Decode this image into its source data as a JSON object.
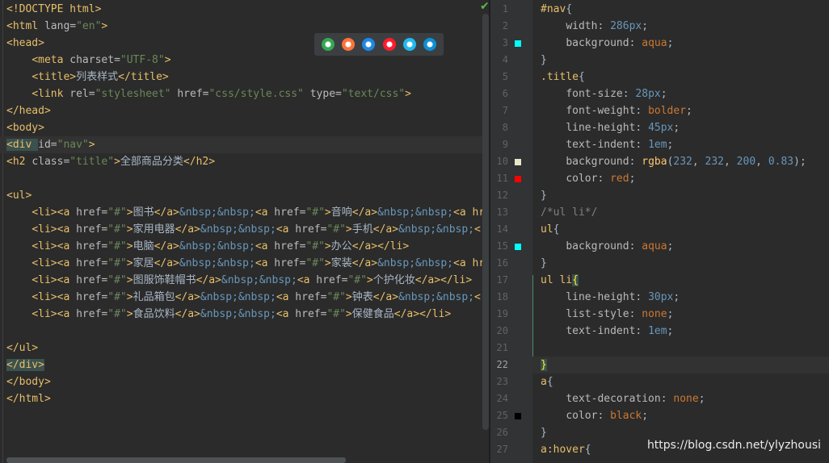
{
  "html_editor": {
    "lines": [
      [
        [
          "tag",
          "<!DOCTYPE html>"
        ]
      ],
      [
        [
          "tag",
          "<html "
        ],
        [
          "attr",
          "lang="
        ],
        [
          "str",
          "\"en\""
        ],
        [
          "tag",
          ">"
        ]
      ],
      [
        [
          "tag",
          "<head>"
        ]
      ],
      [
        [
          "txt",
          "    "
        ],
        [
          "tag",
          "<meta "
        ],
        [
          "attr",
          "charset="
        ],
        [
          "str",
          "\"UTF-8\""
        ],
        [
          "tag",
          ">"
        ]
      ],
      [
        [
          "txt",
          "    "
        ],
        [
          "tag",
          "<title>"
        ],
        [
          "txt",
          "列表样式"
        ],
        [
          "tag",
          "</title>"
        ]
      ],
      [
        [
          "txt",
          "    "
        ],
        [
          "tag",
          "<link "
        ],
        [
          "attr",
          "rel="
        ],
        [
          "str",
          "\"stylesheet\""
        ],
        [
          "attr",
          " href="
        ],
        [
          "str",
          "\"css/style.css\""
        ],
        [
          "attr",
          " type="
        ],
        [
          "str",
          "\"text/css\""
        ],
        [
          "tag",
          ">"
        ]
      ],
      [
        [
          "tag",
          "</head>"
        ]
      ],
      [
        [
          "tag",
          "<body>"
        ]
      ],
      [
        [
          "tag",
          "<div "
        ],
        [
          "attr",
          "id="
        ],
        [
          "str",
          "\"nav\""
        ],
        [
          "tag",
          ">"
        ]
      ],
      [
        [
          "tag",
          "<h2 "
        ],
        [
          "attr",
          "class="
        ],
        [
          "str",
          "\"title\""
        ],
        [
          "tag",
          ">"
        ],
        [
          "txt",
          "全部商品分类"
        ],
        [
          "tag",
          "</h2>"
        ]
      ],
      [],
      [
        [
          "tag",
          "<ul>"
        ]
      ],
      [
        [
          "txt",
          "    "
        ],
        [
          "tag",
          "<li><a "
        ],
        [
          "attr",
          "href="
        ],
        [
          "str",
          "\"#\""
        ],
        [
          "tag",
          ">"
        ],
        [
          "txt",
          "图书"
        ],
        [
          "tag",
          "</a>"
        ],
        [
          "ent",
          "&nbsp;&nbsp;"
        ],
        [
          "tag",
          "<a "
        ],
        [
          "attr",
          "href="
        ],
        [
          "str",
          "\"#\""
        ],
        [
          "tag",
          ">"
        ],
        [
          "txt",
          "音响"
        ],
        [
          "tag",
          "</a>"
        ],
        [
          "ent",
          "&nbsp;&nbsp;"
        ],
        [
          "tag",
          "<a hr"
        ]
      ],
      [
        [
          "txt",
          "    "
        ],
        [
          "tag",
          "<li><a "
        ],
        [
          "attr",
          "href="
        ],
        [
          "str",
          "\"#\""
        ],
        [
          "tag",
          ">"
        ],
        [
          "txt",
          "家用电器"
        ],
        [
          "tag",
          "</a>"
        ],
        [
          "ent",
          "&nbsp;&nbsp;"
        ],
        [
          "tag",
          "<a "
        ],
        [
          "attr",
          "href="
        ],
        [
          "str",
          "\"#\""
        ],
        [
          "tag",
          ">"
        ],
        [
          "txt",
          "手机"
        ],
        [
          "tag",
          "</a>"
        ],
        [
          "ent",
          "&nbsp;&nbsp;"
        ],
        [
          "tag",
          "<"
        ]
      ],
      [
        [
          "txt",
          "    "
        ],
        [
          "tag",
          "<li><a "
        ],
        [
          "attr",
          "href="
        ],
        [
          "str",
          "\"#\""
        ],
        [
          "tag",
          ">"
        ],
        [
          "txt",
          "电脑"
        ],
        [
          "tag",
          "</a>"
        ],
        [
          "ent",
          "&nbsp;&nbsp;"
        ],
        [
          "tag",
          "<a "
        ],
        [
          "attr",
          "href="
        ],
        [
          "str",
          "\"#\""
        ],
        [
          "tag",
          ">"
        ],
        [
          "txt",
          "办公"
        ],
        [
          "tag",
          "</a></li>"
        ]
      ],
      [
        [
          "txt",
          "    "
        ],
        [
          "tag",
          "<li><a "
        ],
        [
          "attr",
          "href="
        ],
        [
          "str",
          "\"#\""
        ],
        [
          "tag",
          ">"
        ],
        [
          "txt",
          "家居"
        ],
        [
          "tag",
          "</a>"
        ],
        [
          "ent",
          "&nbsp;&nbsp;"
        ],
        [
          "tag",
          "<a "
        ],
        [
          "attr",
          "href="
        ],
        [
          "str",
          "\"#\""
        ],
        [
          "tag",
          ">"
        ],
        [
          "txt",
          "家装"
        ],
        [
          "tag",
          "</a>"
        ],
        [
          "ent",
          "&nbsp;&nbsp;"
        ],
        [
          "tag",
          "<a hr"
        ]
      ],
      [
        [
          "txt",
          "    "
        ],
        [
          "tag",
          "<li><a "
        ],
        [
          "attr",
          "href="
        ],
        [
          "str",
          "\"#\""
        ],
        [
          "tag",
          ">"
        ],
        [
          "txt",
          "图服饰鞋帽书"
        ],
        [
          "tag",
          "</a>"
        ],
        [
          "ent",
          "&nbsp;&nbsp;"
        ],
        [
          "tag",
          "<a "
        ],
        [
          "attr",
          "href="
        ],
        [
          "str",
          "\"#\""
        ],
        [
          "tag",
          ">"
        ],
        [
          "txt",
          "个护化妆"
        ],
        [
          "tag",
          "</a></li>"
        ]
      ],
      [
        [
          "txt",
          "    "
        ],
        [
          "tag",
          "<li><a "
        ],
        [
          "attr",
          "href="
        ],
        [
          "str",
          "\"#\""
        ],
        [
          "tag",
          ">"
        ],
        [
          "txt",
          "礼品箱包"
        ],
        [
          "tag",
          "</a>"
        ],
        [
          "ent",
          "&nbsp;&nbsp;"
        ],
        [
          "tag",
          "<a "
        ],
        [
          "attr",
          "href="
        ],
        [
          "str",
          "\"#\""
        ],
        [
          "tag",
          ">"
        ],
        [
          "txt",
          "钟表"
        ],
        [
          "tag",
          "</a>"
        ],
        [
          "ent",
          "&nbsp;&nbsp;"
        ],
        [
          "tag",
          "<"
        ]
      ],
      [
        [
          "txt",
          "    "
        ],
        [
          "tag",
          "<li><a "
        ],
        [
          "attr",
          "href="
        ],
        [
          "str",
          "\"#\""
        ],
        [
          "tag",
          ">"
        ],
        [
          "txt",
          "食品饮料"
        ],
        [
          "tag",
          "</a>"
        ],
        [
          "ent",
          "&nbsp;&nbsp;"
        ],
        [
          "tag",
          "<a "
        ],
        [
          "attr",
          "href="
        ],
        [
          "str",
          "\"#\""
        ],
        [
          "tag",
          ">"
        ],
        [
          "txt",
          "保健食品"
        ],
        [
          "tag",
          "</a></li>"
        ]
      ],
      [],
      [
        [
          "tag",
          "</ul>"
        ]
      ],
      [
        [
          "tag",
          "</div>"
        ]
      ],
      [
        [
          "tag",
          "</body>"
        ]
      ],
      [
        [
          "tag",
          "</html>"
        ]
      ]
    ],
    "highlighted_line": 8
  },
  "css_editor": {
    "line_numbers": [
      "1",
      "2",
      "3",
      "4",
      "5",
      "6",
      "7",
      "8",
      "9",
      "10",
      "11",
      "12",
      "13",
      "14",
      "15",
      "16",
      "17",
      "18",
      "19",
      "20",
      "21",
      "22",
      "23",
      "24",
      "25",
      "26",
      "27"
    ],
    "active_line": 22,
    "lines": [
      [
        [
          "sel",
          "#nav"
        ],
        [
          "pun",
          "{"
        ]
      ],
      [
        [
          "txt",
          "    "
        ],
        [
          "prop",
          "width"
        ],
        [
          "pun",
          ": "
        ],
        [
          "num",
          "286px"
        ],
        [
          "pun",
          ";"
        ]
      ],
      [
        [
          "txt",
          "    "
        ],
        [
          "prop",
          "background"
        ],
        [
          "pun",
          ": "
        ],
        [
          "val",
          "aqua"
        ],
        [
          "pun",
          ";"
        ]
      ],
      [
        [
          "pun",
          "}"
        ]
      ],
      [
        [
          "sel",
          ".title"
        ],
        [
          "pun",
          "{"
        ]
      ],
      [
        [
          "txt",
          "    "
        ],
        [
          "prop",
          "font-size"
        ],
        [
          "pun",
          ": "
        ],
        [
          "num",
          "28px"
        ],
        [
          "pun",
          ";"
        ]
      ],
      [
        [
          "txt",
          "    "
        ],
        [
          "prop",
          "font-weight"
        ],
        [
          "pun",
          ": "
        ],
        [
          "val",
          "bolder"
        ],
        [
          "pun",
          ";"
        ]
      ],
      [
        [
          "txt",
          "    "
        ],
        [
          "prop",
          "line-height"
        ],
        [
          "pun",
          ": "
        ],
        [
          "num",
          "45px"
        ],
        [
          "pun",
          ";"
        ]
      ],
      [
        [
          "txt",
          "    "
        ],
        [
          "prop",
          "text-indent"
        ],
        [
          "pun",
          ": "
        ],
        [
          "num",
          "1em"
        ],
        [
          "pun",
          ";"
        ]
      ],
      [
        [
          "txt",
          "    "
        ],
        [
          "prop",
          "background"
        ],
        [
          "pun",
          ": "
        ],
        [
          "fn",
          "rgba"
        ],
        [
          "pun",
          "("
        ],
        [
          "num",
          "232"
        ],
        [
          "pun",
          ", "
        ],
        [
          "num",
          "232"
        ],
        [
          "pun",
          ", "
        ],
        [
          "num",
          "200"
        ],
        [
          "pun",
          ", "
        ],
        [
          "num",
          "0.83"
        ],
        [
          "pun",
          ");"
        ]
      ],
      [
        [
          "txt",
          "    "
        ],
        [
          "prop",
          "color"
        ],
        [
          "pun",
          ": "
        ],
        [
          "val",
          "red"
        ],
        [
          "pun",
          ";"
        ]
      ],
      [
        [
          "pun",
          "}"
        ]
      ],
      [
        [
          "cmt",
          "/*ul li*/"
        ]
      ],
      [
        [
          "sel",
          "ul"
        ],
        [
          "pun",
          "{"
        ]
      ],
      [
        [
          "txt",
          "    "
        ],
        [
          "prop",
          "background"
        ],
        [
          "pun",
          ": "
        ],
        [
          "val",
          "aqua"
        ],
        [
          "pun",
          ";"
        ]
      ],
      [
        [
          "pun",
          "}"
        ]
      ],
      [
        [
          "sel",
          "ul li"
        ],
        [
          "pun",
          "{"
        ]
      ],
      [
        [
          "txt",
          "    "
        ],
        [
          "prop",
          "line-height"
        ],
        [
          "pun",
          ": "
        ],
        [
          "num",
          "30px"
        ],
        [
          "pun",
          ";"
        ]
      ],
      [
        [
          "txt",
          "    "
        ],
        [
          "prop",
          "list-style"
        ],
        [
          "pun",
          ": "
        ],
        [
          "val",
          "none"
        ],
        [
          "pun",
          ";"
        ]
      ],
      [
        [
          "txt",
          "    "
        ],
        [
          "prop",
          "text-indent"
        ],
        [
          "pun",
          ": "
        ],
        [
          "num",
          "1em"
        ],
        [
          "pun",
          ";"
        ]
      ],
      [],
      [
        [
          "pun",
          "}"
        ]
      ],
      [
        [
          "sel",
          "a"
        ],
        [
          "pun",
          "{"
        ]
      ],
      [
        [
          "txt",
          "    "
        ],
        [
          "prop",
          "text-decoration"
        ],
        [
          "pun",
          ": "
        ],
        [
          "val",
          "none"
        ],
        [
          "pun",
          ";"
        ]
      ],
      [
        [
          "txt",
          "    "
        ],
        [
          "prop",
          "color"
        ],
        [
          "pun",
          ": "
        ],
        [
          "val",
          "black"
        ],
        [
          "pun",
          ";"
        ]
      ],
      [
        [
          "pun",
          "}"
        ]
      ],
      [
        [
          "sel",
          "a:hover"
        ],
        [
          "pun",
          "{"
        ]
      ]
    ],
    "color_swatches": [
      {
        "line": 3,
        "color": "#00ffff"
      },
      {
        "line": 10,
        "color": "#e8e8c8"
      },
      {
        "line": 11,
        "color": "#ff0000"
      },
      {
        "line": 15,
        "color": "#00ffff"
      },
      {
        "line": 25,
        "color": "#000000"
      }
    ]
  },
  "browser_icons": [
    {
      "name": "chrome-icon",
      "color": "#34a853"
    },
    {
      "name": "firefox-icon",
      "color": "#ff7139"
    },
    {
      "name": "safari-icon",
      "color": "#1e88e5"
    },
    {
      "name": "opera-icon",
      "color": "#ff1b2d"
    },
    {
      "name": "ie-icon",
      "color": "#1ebbee"
    },
    {
      "name": "edge-icon",
      "color": "#0c8fd4"
    }
  ],
  "status": {
    "check_symbol": "✔"
  },
  "watermark": "https://blog.csdn.net/ylyzhousi"
}
